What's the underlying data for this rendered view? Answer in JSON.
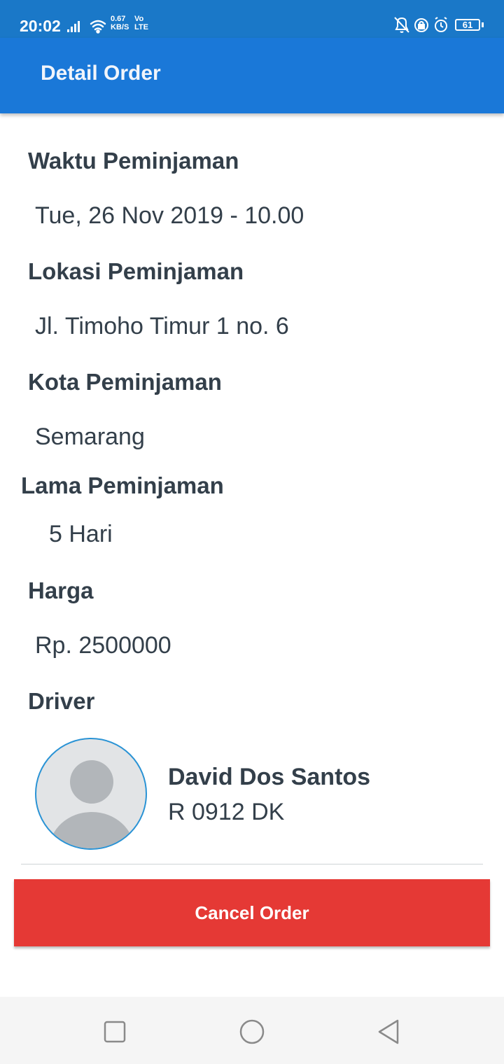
{
  "status_bar": {
    "time": "20:02",
    "net_speed_value": "0.67",
    "net_speed_unit": "KB/S",
    "net_type_top": "Vo",
    "net_type_bottom": "LTE",
    "battery": "61",
    "icons": [
      "signal-icon",
      "wifi-icon",
      "mute-icon",
      "lock-icon",
      "alarm-icon",
      "battery-icon"
    ]
  },
  "app_bar": {
    "title": "Detail Order"
  },
  "details": {
    "waktu_label": "Waktu Peminjaman",
    "waktu_value": "Tue, 26 Nov 2019 - 10.00",
    "lokasi_label": "Lokasi Peminjaman",
    "lokasi_value": "Jl. Timoho Timur 1 no. 6",
    "kota_label": "Kota Peminjaman",
    "kota_value": "Semarang",
    "lama_label": "Lama Peminjaman",
    "lama_value": "5 Hari",
    "harga_label": "Harga",
    "harga_value": "Rp. 2500000",
    "driver_label": "Driver"
  },
  "driver": {
    "name": "David Dos Santos",
    "plate": "R 0912 DK"
  },
  "actions": {
    "cancel_label": "Cancel Order"
  },
  "nav_bar": {
    "icons": [
      "recents-icon",
      "home-icon",
      "back-icon"
    ]
  },
  "colors": {
    "app_bar": "#1a78d8",
    "status_bar": "#1a78c8",
    "cancel_button": "#e53935",
    "text": "#333f4a"
  }
}
